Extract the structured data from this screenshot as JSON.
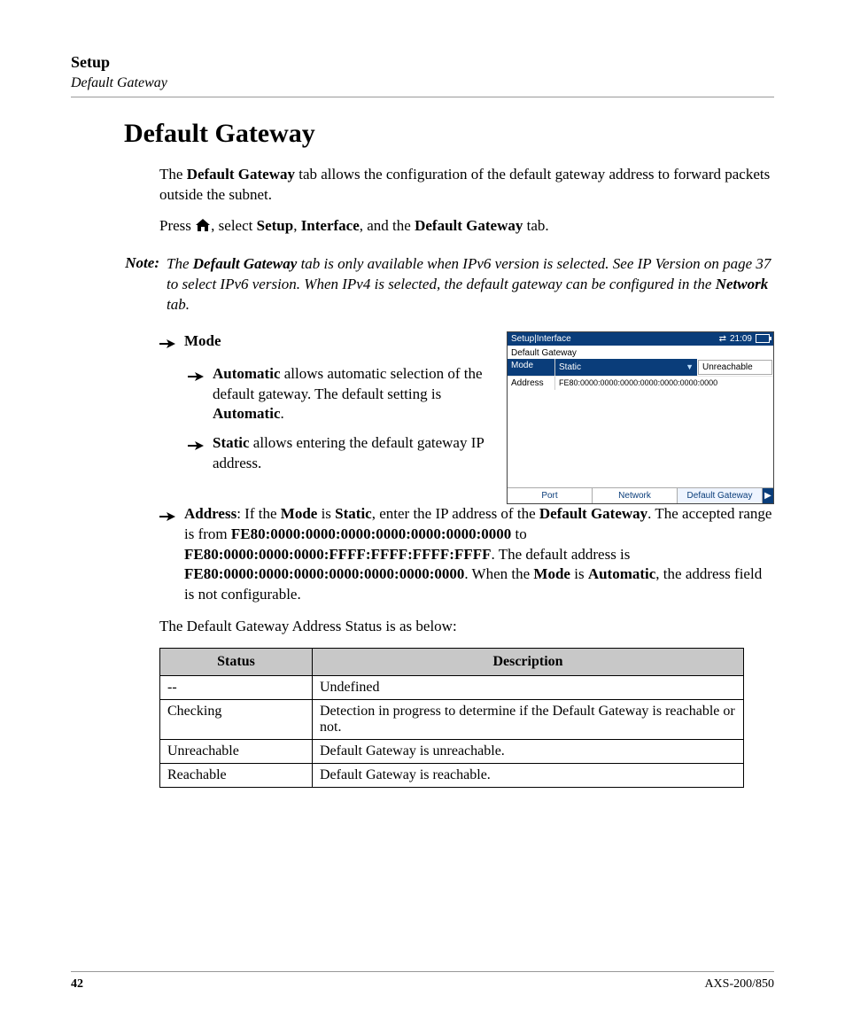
{
  "header": {
    "chapter": "Setup",
    "section": "Default Gateway"
  },
  "heading": "Default Gateway",
  "intro": {
    "p1_pre": "The ",
    "p1_bold": "Default Gateway",
    "p1_post": " tab allows the configuration of the default gateway address to forward packets outside the subnet.",
    "p2_pre": "Press ",
    "p2_mid": ", select ",
    "p2_b1": "Setup",
    "p2_c1": ", ",
    "p2_b2": "Interface",
    "p2_c2": ", and the ",
    "p2_b3": "Default Gateway",
    "p2_post": " tab."
  },
  "note": {
    "label": "Note:",
    "t1": "The ",
    "b1": "Default Gateway",
    "t2": " tab is only available when IPv6 version is selected. See IP Version on page 37 to select IPv6 version. When IPv4 is selected, the default gateway can be configured in the ",
    "b2": "Network",
    "t3": " tab."
  },
  "bullets": {
    "mode_label": "Mode",
    "auto_b": "Automatic",
    "auto_t1": " allows automatic selection of the default gateway. The default setting is ",
    "auto_b2": "Automatic",
    "auto_t2": ".",
    "static_b": "Static",
    "static_t": " allows entering the default gateway IP address.",
    "addr_b1": "Address",
    "addr_t1": ": If the ",
    "addr_b2": "Mode",
    "addr_t2": " is ",
    "addr_b3": "Static",
    "addr_t3": ", enter the IP address of the ",
    "addr_b4": "Default Gateway",
    "addr_t4": ". The accepted range is from ",
    "addr_b5": "FE80:0000:0000:0000:0000:0000:0000:0000",
    "addr_t5": " to ",
    "addr_b6": "FE80:0000:0000:0000:FFFF:FFFF:FFFF:FFFF",
    "addr_t6": ". The default address is ",
    "addr_b7": "FE80:0000:0000:0000:0000:0000:0000:0000",
    "addr_t7": ". When the ",
    "addr_b8": "Mode",
    "addr_t8": " is ",
    "addr_b9": "Automatic",
    "addr_t9": ", the address field is not configurable."
  },
  "screenshot": {
    "titlebar": "Setup|Interface",
    "time": "21:09",
    "section": "Default Gateway",
    "mode_label": "Mode",
    "mode_value": "Static",
    "status_value": "Unreachable",
    "addr_label": "Address",
    "addr_value": "FE80:0000:0000:0000:0000:0000:0000:0000",
    "tabs": {
      "port": "Port",
      "network": "Network",
      "dgw": "Default Gateway"
    }
  },
  "status_intro": "The Default Gateway Address Status is as below:",
  "table": {
    "headers": {
      "status": "Status",
      "desc": "Description"
    },
    "rows": [
      {
        "status": "--",
        "desc": "Undefined"
      },
      {
        "status": "Checking",
        "desc": "Detection in progress to determine if the Default Gateway is reachable or not."
      },
      {
        "status": "Unreachable",
        "desc": "Default Gateway is unreachable."
      },
      {
        "status": "Reachable",
        "desc": "Default Gateway is reachable."
      }
    ]
  },
  "footer": {
    "page": "42",
    "model": "AXS-200/850"
  }
}
